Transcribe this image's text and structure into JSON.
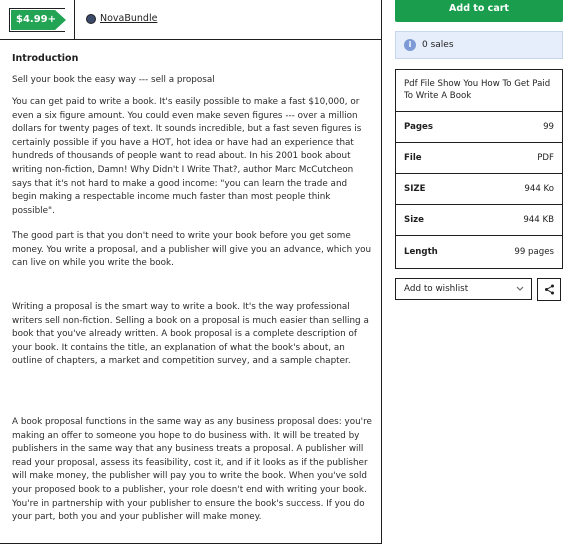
{
  "product": {
    "price": "$4.99+",
    "seller_name": "NovaBundle",
    "section_title": "Introduction",
    "paragraphs": [
      "Sell your book the easy way --- sell a proposal",
      "You can get paid to write a book. It's easily possible to make a fast $10,000, or even a six figure amount. You could even make seven figures --- over a million dollars for twenty pages of text. It sounds incredible, but a fast seven figures is certainly possible if you have a HOT, hot idea or have had an experience that hundreds of thousands of people want to read about. In his 2001 book about writing non-fiction, Damn! Why Didn't I Write That?, author Marc McCutcheon says that it's not hard to make a good income: \"you can learn the trade and begin making a respectable income much faster than most people think possible\".",
      "The good part is that you don't need to write your book before you get some money. You write a proposal, and a publisher will give you an advance, which you can live on while you write the book.",
      "Writing a proposal is the smart way to write a book. It's the way professional writers sell non-fiction. Selling a book on a proposal is much easier than selling a book that you've already written. A book proposal is a complete description of your book. It contains the title, an explanation of what the book's about, an outline of chapters, a market and competition survey, and a sample chapter.",
      "A book proposal functions in the same way as any business proposal does: you're making an offer to someone you hope to do business with. It will be treated by publishers in the same way that any business treats a proposal. A publisher will read your proposal, assess its feasibility, cost it, and if it looks as if the publisher will make money, the publisher will pay you to write the book. When you've sold your proposed book to a publisher, your role doesn't end with writing your book. You're in partnership with your publisher to ensure the book's success. If you do your part, both you and your publisher will make money."
    ]
  },
  "sidebar": {
    "cart_label": "Add to cart",
    "sales_text": "0 sales",
    "info_title": "Pdf File Show You How To Get Paid To Write A Book",
    "info_rows": [
      {
        "label": "Pages",
        "value": "99"
      },
      {
        "label": "File",
        "value": "PDF"
      },
      {
        "label": "SIZE",
        "value": "944 Ko"
      },
      {
        "label": "Size",
        "value": "944 KB"
      },
      {
        "label": "Length",
        "value": "99 pages"
      }
    ],
    "wishlist_label": "Add to wishlist"
  },
  "colors": {
    "accent_green": "#23a455",
    "cart_green": "#1a9e4d",
    "info_blue_bg": "#e6eefb"
  },
  "icons": {
    "info": "info-icon",
    "chevron": "chevron-down-icon",
    "share": "share-icon",
    "avatar": "seller-avatar"
  }
}
